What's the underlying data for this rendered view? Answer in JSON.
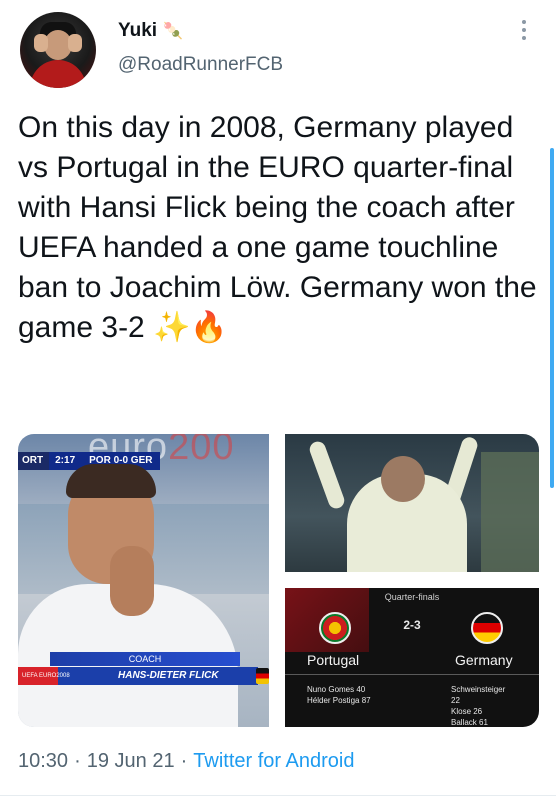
{
  "author": {
    "display_name": "Yuki",
    "name_emoji": "🍡",
    "handle": "@RoadRunnerFCB"
  },
  "tweet": {
    "text": "On this day in 2008, Germany played vs Portugal in the EURO quarter-final with Hansi Flick being the coach after UEFA handed a one game touchline ban to Joachim Löw. Germany won the game 3-2 ✨🔥"
  },
  "media": {
    "photo1": {
      "watermark": "euro",
      "watermark_year": "200",
      "scorebug_left": "ORT",
      "scorebug_clock": "2:17",
      "scorebug_score": "POR 0-0 GER",
      "caption_role": "COACH",
      "caption_name": "HANS-DIETER FLICK",
      "caption_tag": "UEFA EURO2008"
    },
    "photo3": {
      "stage": "Quarter-finals",
      "score": "2-3",
      "home_team": "Portugal",
      "away_team": "Germany",
      "home_scorers": [
        "Nuno Gomes 40",
        "Hélder Postiga 87"
      ],
      "away_scorers": [
        "Schweinsteiger",
        "22",
        "Klose 26",
        "Ballack 61"
      ]
    }
  },
  "meta": {
    "time": "10:30",
    "sep1": "·",
    "date": "19 Jun 21",
    "sep2": "·",
    "source": "Twitter for Android"
  },
  "colors": {
    "link": "#1d9bf0",
    "secondary_text": "#536471"
  },
  "icons": {
    "more": "more-vertical-icon"
  }
}
